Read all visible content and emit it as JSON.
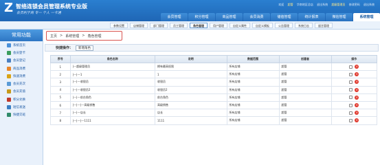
{
  "header": {
    "logo_char": "Z",
    "title": "智络连锁会员管理系统专业版",
    "slogan": "会员利于商 专一 个人 一卡通",
    "user_label": "欢迎",
    "username": "超管",
    "store": "华南地区总店",
    "logout": "退出系统",
    "role": "超级管理员",
    "change_pw": "修改密码",
    "help": "退出系统"
  },
  "nav": {
    "items": [
      "会员管理",
      "积分管理",
      "商品管理",
      "会员消费",
      "储值管理",
      "统计报表",
      "微信管理",
      "系统管理"
    ],
    "active": "系统管理"
  },
  "subnav": {
    "items": [
      "参数设置",
      "店铺管理",
      "部门管理",
      "员工管理",
      "角色管理",
      "用户管理",
      "自定义属性",
      "自定义模板",
      "公告管理",
      "系统日志",
      "留言管理"
    ],
    "active": "角色管理"
  },
  "sidebar": {
    "title": "常用功能",
    "items": [
      {
        "label": "系统首页",
        "icon": "home-icon",
        "color": "#4a90d9"
      },
      {
        "label": "会员登卡",
        "icon": "user-add-icon",
        "color": "#3a9d5d"
      },
      {
        "label": "会员登记",
        "icon": "user-icon",
        "color": "#4a7fc1"
      },
      {
        "label": "商品消费",
        "icon": "cart-icon",
        "color": "#e8862a"
      },
      {
        "label": "快速消费",
        "icon": "lightning-icon",
        "color": "#d9a416"
      },
      {
        "label": "会员充次",
        "icon": "card-icon",
        "color": "#5a9bd6"
      },
      {
        "label": "会员充值",
        "icon": "coin-icon",
        "color": "#c79a1a"
      },
      {
        "label": "积分兑换",
        "icon": "gift-icon",
        "color": "#c0392b"
      },
      {
        "label": "短信发送",
        "icon": "sms-icon",
        "color": "#3a7fc4"
      },
      {
        "label": "快捷交班",
        "icon": "exchange-icon",
        "color": "#2f8a6a"
      }
    ]
  },
  "breadcrumb": {
    "items": [
      "主页",
      ">",
      "系统管理",
      ">",
      "角色管理"
    ]
  },
  "quick": {
    "label": "快捷操作：",
    "button": "新增角色"
  },
  "table": {
    "headers": [
      "序号",
      "角色名称",
      "说明",
      "数据范围",
      "创建者",
      "操作"
    ],
    "rows": [
      {
        "no": "1",
        "name": "|---超级管理员",
        "desc": "拥有最高权限",
        "scope": "所有店铺",
        "creator": "超管"
      },
      {
        "no": "2",
        "name": "|---|---1",
        "desc": "1",
        "scope": "所有店铺",
        "creator": "超管"
      },
      {
        "no": "3",
        "name": "|---|---收银员",
        "desc": "收银员",
        "scope": "所有店铺",
        "creator": "超管"
      },
      {
        "no": "4",
        "name": "|---|---收银员2",
        "desc": "收银员2",
        "scope": "所有店铺",
        "creator": "超管"
      },
      {
        "no": "5",
        "name": "|---|---前台角色",
        "desc": "前台角色",
        "scope": "所有店铺",
        "creator": "超管"
      },
      {
        "no": "6",
        "name": "|---|---|---高级销售",
        "desc": "高级销售",
        "scope": "所有店铺",
        "creator": "超管"
      },
      {
        "no": "7",
        "name": "|---|---店长",
        "desc": "店长",
        "scope": "所有店铺",
        "creator": "超管"
      },
      {
        "no": "8",
        "name": "|---|---|---1111",
        "desc": "1111",
        "scope": "所有店铺",
        "creator": "超管"
      }
    ]
  }
}
